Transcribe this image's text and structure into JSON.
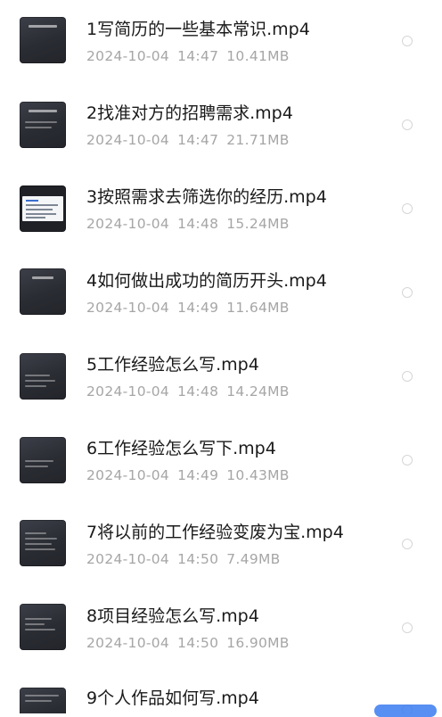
{
  "files": [
    {
      "name": "1写简历的一些基本常识.mp4",
      "date": "2024-10-04",
      "time": "14:47",
      "size": "10.41MB",
      "thumb_icon": "video-thumbnail-icon"
    },
    {
      "name": "2找准对方的招聘需求.mp4",
      "date": "2024-10-04",
      "time": "14:47",
      "size": "21.71MB",
      "thumb_icon": "video-thumbnail-icon"
    },
    {
      "name": "3按照需求去筛选你的经历.mp4",
      "date": "2024-10-04",
      "time": "14:48",
      "size": "15.24MB",
      "thumb_icon": "video-thumbnail-icon"
    },
    {
      "name": "4如何做出成功的简历开头.mp4",
      "date": "2024-10-04",
      "time": "14:49",
      "size": "11.64MB",
      "thumb_icon": "video-thumbnail-icon"
    },
    {
      "name": "5工作经验怎么写.mp4",
      "date": "2024-10-04",
      "time": "14:48",
      "size": "14.24MB",
      "thumb_icon": "video-thumbnail-icon"
    },
    {
      "name": "6工作经验怎么写下.mp4",
      "date": "2024-10-04",
      "time": "14:49",
      "size": "10.43MB",
      "thumb_icon": "video-thumbnail-icon"
    },
    {
      "name": "7将以前的工作经验变废为宝.mp4",
      "date": "2024-10-04",
      "time": "14:50",
      "size": "7.49MB",
      "thumb_icon": "video-thumbnail-icon"
    },
    {
      "name": "8项目经验怎么写.mp4",
      "date": "2024-10-04",
      "time": "14:50",
      "size": "16.90MB",
      "thumb_icon": "video-thumbnail-icon"
    },
    {
      "name": "9个人作品如何写.mp4",
      "date": "",
      "time": "",
      "size": "",
      "thumb_icon": "video-thumbnail-icon"
    }
  ],
  "colors": {
    "name_text": "#1a1a1a",
    "meta_text": "#a6a6a6",
    "radio_border": "#d6d6d6",
    "accent": "#3a7bf0"
  }
}
